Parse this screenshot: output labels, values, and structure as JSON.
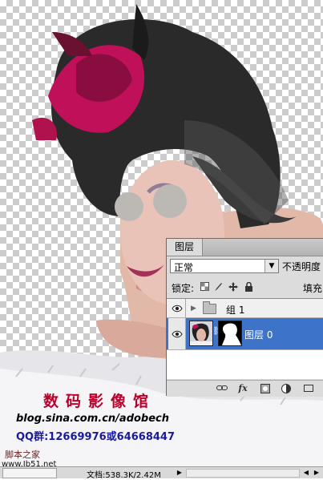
{
  "watermark": {
    "title": "数码影像馆",
    "blog": "blog.sina.com.cn/adobech",
    "qq": "QQ群:12669976或64668447",
    "site_name": "脚本之家",
    "site_url": "www.Jb51.net"
  },
  "layers_panel": {
    "tab_label": "图层",
    "blend_mode": "正常",
    "opacity_label": "不透明度",
    "lock_label": "锁定:",
    "fill_label": "填充",
    "lock_icons": [
      "lock-transparent-icon",
      "lock-brush-icon",
      "lock-move-icon",
      "lock-all-icon"
    ],
    "layers": [
      {
        "type": "group",
        "name": "组 1",
        "visible": true,
        "expanded": false
      },
      {
        "type": "layer",
        "name": "图层 0",
        "visible": true,
        "selected": true,
        "has_mask": true
      }
    ],
    "footer_icons": [
      "link-icon",
      "fx-icon",
      "add-mask-icon",
      "adjustment-layer-icon",
      "new-group-icon"
    ],
    "footer_fx_label": "fx"
  },
  "status_bar": {
    "doc_info": "文档:538.3K/2.42M"
  },
  "colors": {
    "selection": "#3d73c8",
    "panel_bg": "#dcdcdc",
    "watermark_red": "#b8002a",
    "watermark_blue": "#1a1a9a"
  }
}
